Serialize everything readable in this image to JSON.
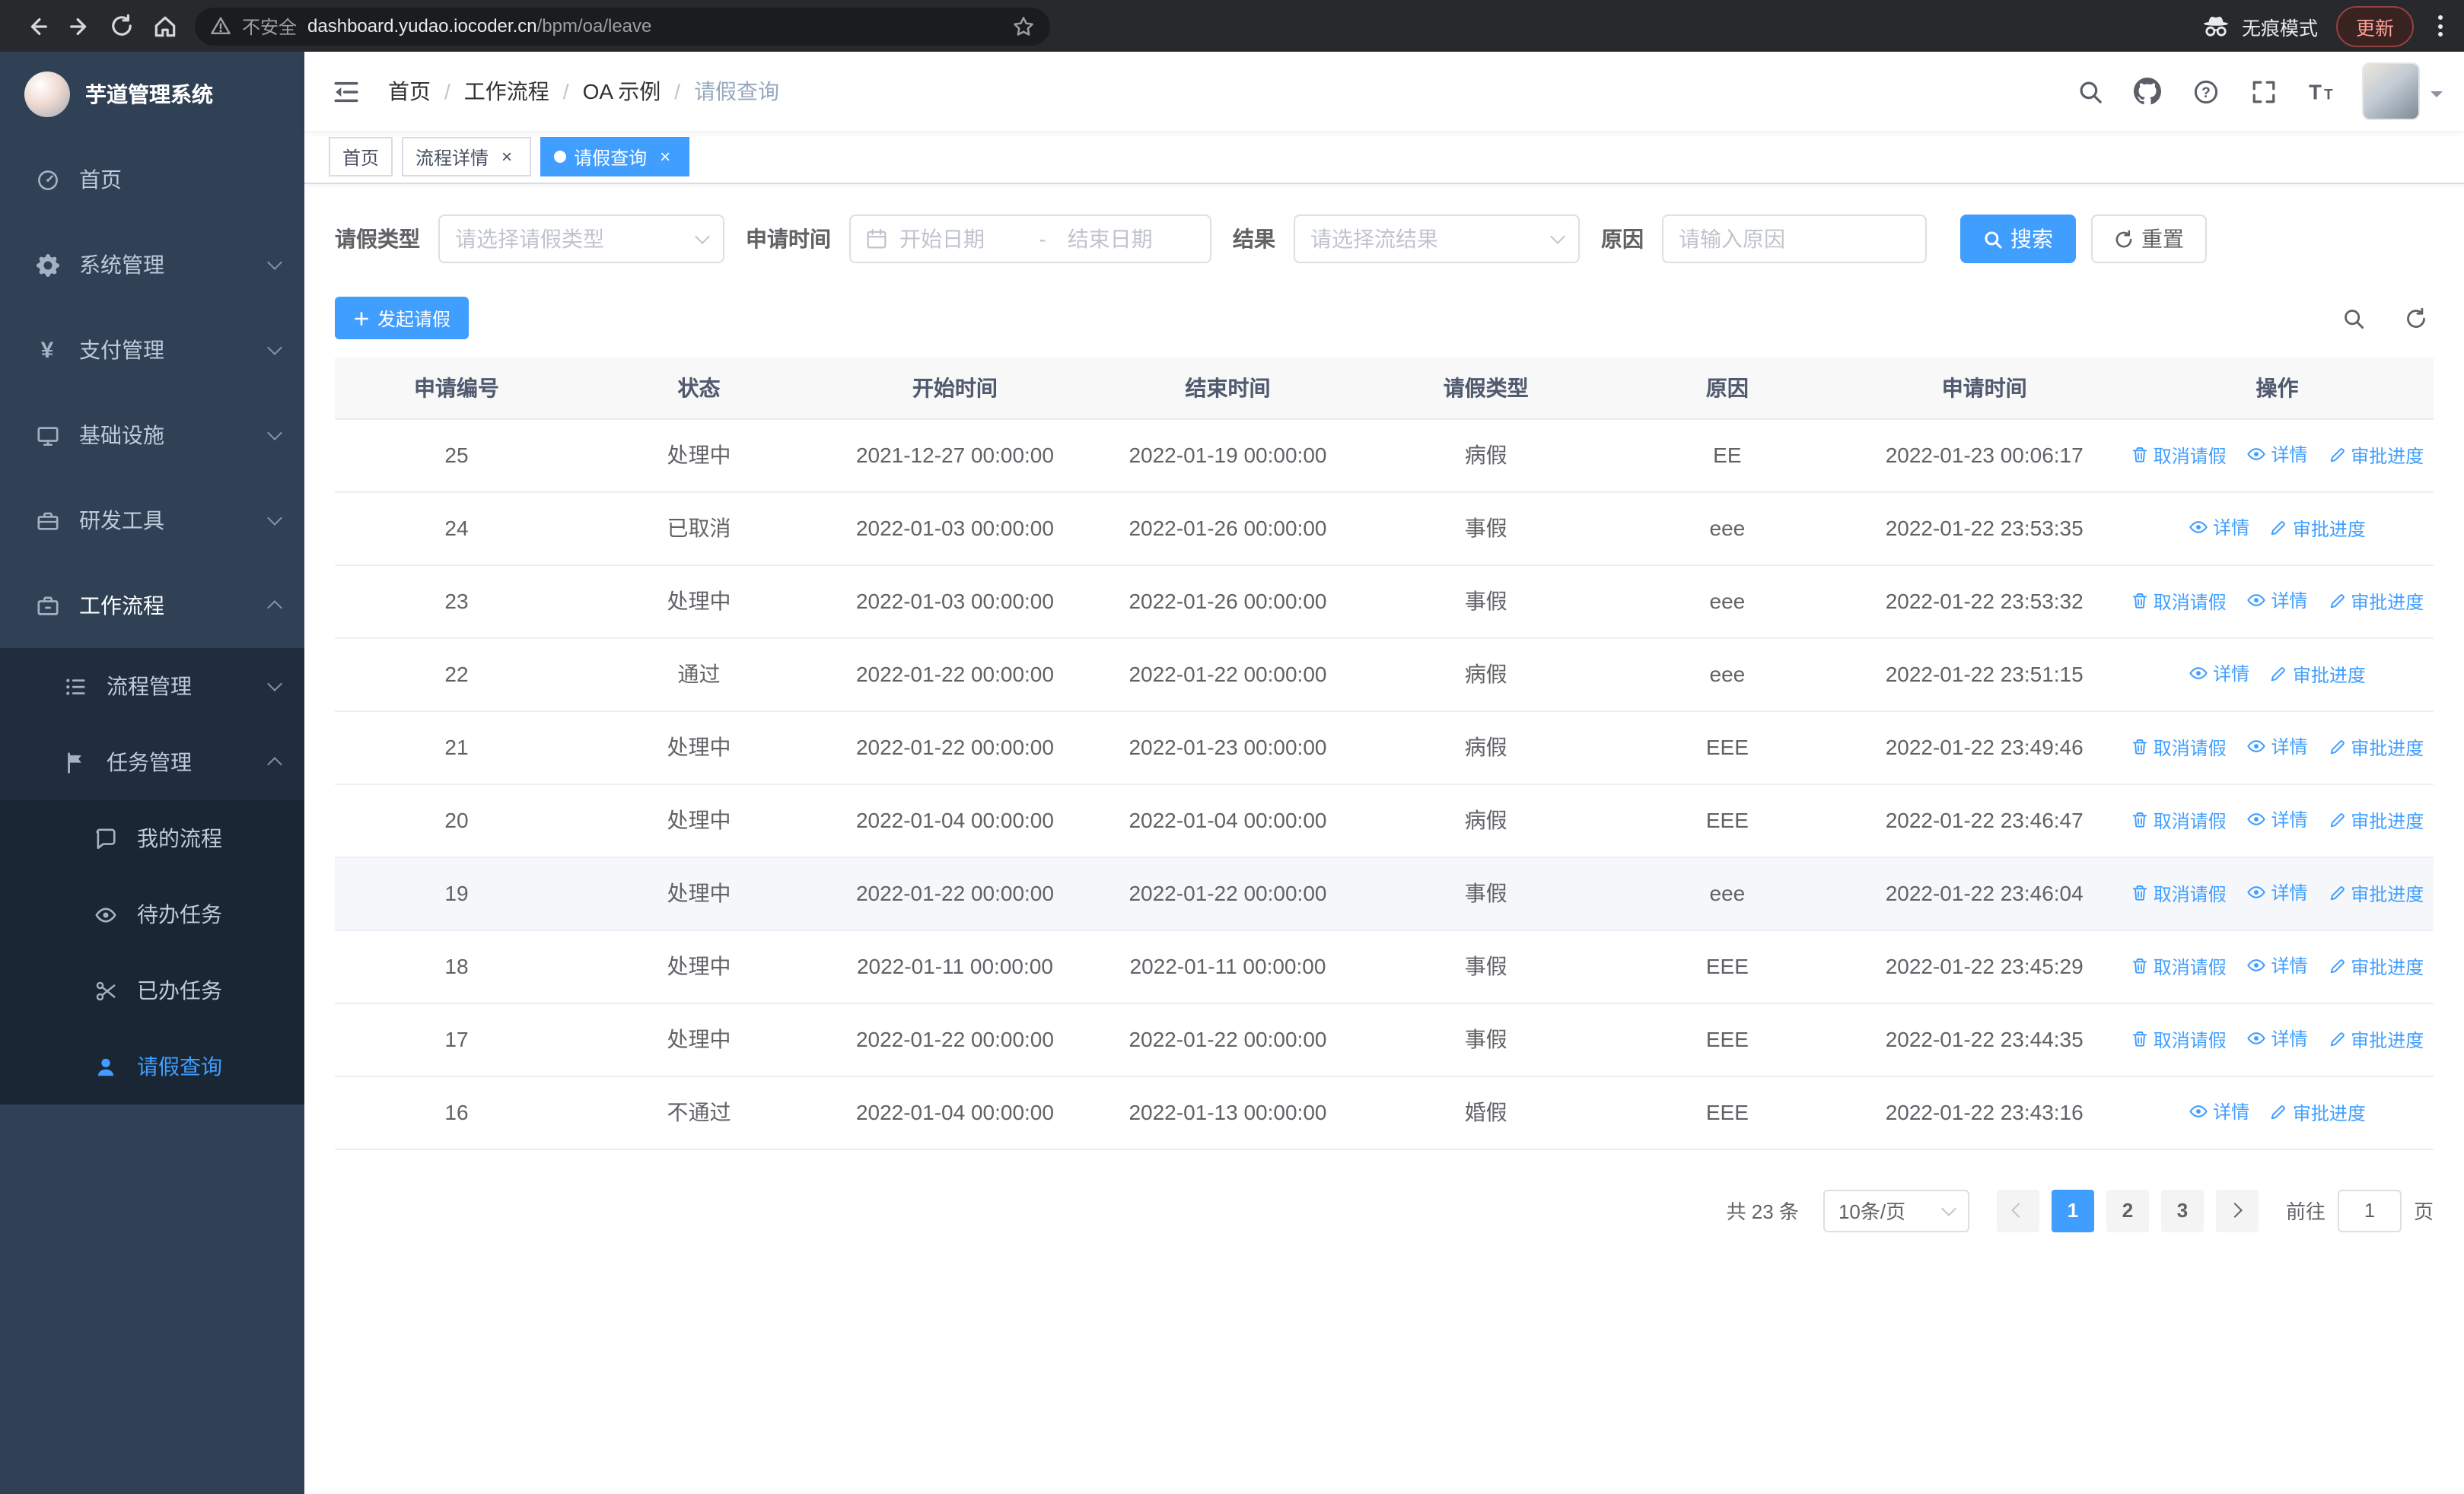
{
  "browser": {
    "security_label": "不安全",
    "url_host": "dashboard.yudao.iocoder.cn",
    "url_path": "/bpm/oa/leave",
    "incognito_label": "无痕模式",
    "update_label": "更新"
  },
  "sidebar": {
    "logo_title": "芋道管理系统",
    "menu": {
      "home": "首页",
      "system": "系统管理",
      "payment": "支付管理",
      "infra": "基础设施",
      "devtools": "研发工具",
      "workflow": "工作流程",
      "process_mgmt": "流程管理",
      "task_mgmt": "任务管理",
      "my_process": "我的流程",
      "todo_tasks": "待办任务",
      "done_tasks": "已办任务",
      "leave_query": "请假查询"
    }
  },
  "navbar": {
    "breadcrumb": {
      "items": [
        "首页",
        "工作流程",
        "OA 示例",
        "请假查询"
      ],
      "separator": "/"
    }
  },
  "tabs": {
    "home": "首页",
    "process_detail": "流程详情",
    "leave_query": "请假查询"
  },
  "filters": {
    "leave_type_label": "请假类型",
    "leave_type_placeholder": "请选择请假类型",
    "apply_time_label": "申请时间",
    "start_date_placeholder": "开始日期",
    "range_separator": "-",
    "end_date_placeholder": "结束日期",
    "result_label": "结果",
    "result_placeholder": "请选择流结果",
    "reason_label": "原因",
    "reason_placeholder": "请输入原因",
    "search_label": "搜索",
    "reset_label": "重置"
  },
  "toolbar": {
    "create_label": "发起请假"
  },
  "table": {
    "columns": [
      "申请编号",
      "状态",
      "开始时间",
      "结束时间",
      "请假类型",
      "原因",
      "申请时间",
      "操作"
    ],
    "action_labels": {
      "cancel": "取消请假",
      "detail": "详情",
      "progress": "审批进度"
    },
    "rows": [
      {
        "id": "25",
        "status": "处理中",
        "start_time": "2021-12-27 00:00:00",
        "end_time": "2022-01-19 00:00:00",
        "leave_type": "病假",
        "reason": "EE",
        "apply_time": "2022-01-23 00:06:17",
        "can_cancel": true,
        "highlighted": false
      },
      {
        "id": "24",
        "status": "已取消",
        "start_time": "2022-01-03 00:00:00",
        "end_time": "2022-01-26 00:00:00",
        "leave_type": "事假",
        "reason": "eee",
        "apply_time": "2022-01-22 23:53:35",
        "can_cancel": false,
        "highlighted": false
      },
      {
        "id": "23",
        "status": "处理中",
        "start_time": "2022-01-03 00:00:00",
        "end_time": "2022-01-26 00:00:00",
        "leave_type": "事假",
        "reason": "eee",
        "apply_time": "2022-01-22 23:53:32",
        "can_cancel": true,
        "highlighted": false
      },
      {
        "id": "22",
        "status": "通过",
        "start_time": "2022-01-22 00:00:00",
        "end_time": "2022-01-22 00:00:00",
        "leave_type": "病假",
        "reason": "eee",
        "apply_time": "2022-01-22 23:51:15",
        "can_cancel": false,
        "highlighted": false
      },
      {
        "id": "21",
        "status": "处理中",
        "start_time": "2022-01-22 00:00:00",
        "end_time": "2022-01-23 00:00:00",
        "leave_type": "病假",
        "reason": "EEE",
        "apply_time": "2022-01-22 23:49:46",
        "can_cancel": true,
        "highlighted": false
      },
      {
        "id": "20",
        "status": "处理中",
        "start_time": "2022-01-04 00:00:00",
        "end_time": "2022-01-04 00:00:00",
        "leave_type": "病假",
        "reason": "EEE",
        "apply_time": "2022-01-22 23:46:47",
        "can_cancel": true,
        "highlighted": false
      },
      {
        "id": "19",
        "status": "处理中",
        "start_time": "2022-01-22 00:00:00",
        "end_time": "2022-01-22 00:00:00",
        "leave_type": "事假",
        "reason": "eee",
        "apply_time": "2022-01-22 23:46:04",
        "can_cancel": true,
        "highlighted": true
      },
      {
        "id": "18",
        "status": "处理中",
        "start_time": "2022-01-11 00:00:00",
        "end_time": "2022-01-11 00:00:00",
        "leave_type": "事假",
        "reason": "EEE",
        "apply_time": "2022-01-22 23:45:29",
        "can_cancel": true,
        "highlighted": false
      },
      {
        "id": "17",
        "status": "处理中",
        "start_time": "2022-01-22 00:00:00",
        "end_time": "2022-01-22 00:00:00",
        "leave_type": "事假",
        "reason": "EEE",
        "apply_time": "2022-01-22 23:44:35",
        "can_cancel": true,
        "highlighted": false
      },
      {
        "id": "16",
        "status": "不通过",
        "start_time": "2022-01-04 00:00:00",
        "end_time": "2022-01-13 00:00:00",
        "leave_type": "婚假",
        "reason": "EEE",
        "apply_time": "2022-01-22 23:43:16",
        "can_cancel": false,
        "highlighted": false
      }
    ]
  },
  "pagination": {
    "total_text": "共 23 条",
    "page_size": "10条/页",
    "pages": [
      "1",
      "2",
      "3"
    ],
    "active_page": "1",
    "goto_label": "前往",
    "goto_value": "1",
    "page_unit": "页"
  },
  "colors": {
    "primary": "#409EFF",
    "sidebar_bg": "#304156",
    "sidebar_sub_bg": "#1f2d3d"
  }
}
